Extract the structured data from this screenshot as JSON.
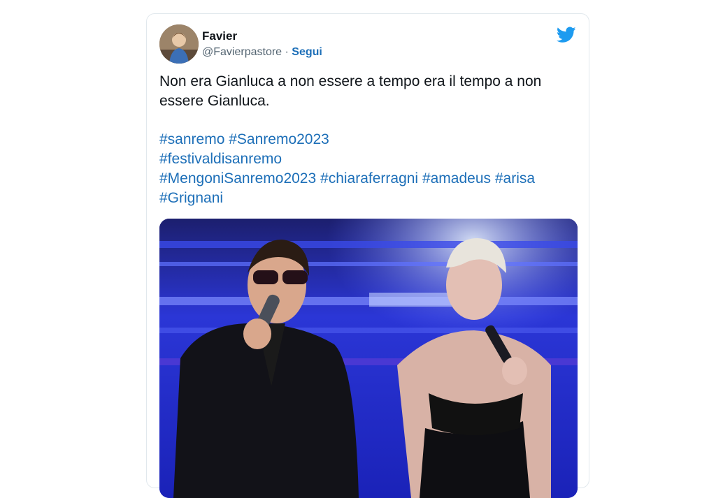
{
  "tweet": {
    "author_name": "Favier",
    "handle": "@Favierpastore",
    "separator": "·",
    "follow_label": "Segui",
    "text": "Non era Gianluca a non essere a tempo era il tempo a non essere Gianluca.",
    "hashtags": [
      [
        "#sanremo",
        "#Sanremo2023"
      ],
      [
        "#festivaldisanremo"
      ],
      [
        "#MengoniSanremo2023",
        "#chiaraferragni",
        "#amadeus",
        "#arisa"
      ],
      [
        "#Grignani"
      ]
    ]
  },
  "icons": {
    "brand": "twitter-bird-icon"
  },
  "colors": {
    "link": "#1d6fb8",
    "twitter_blue": "#1d9bf0",
    "stage_blue": "#1a1fa8"
  }
}
